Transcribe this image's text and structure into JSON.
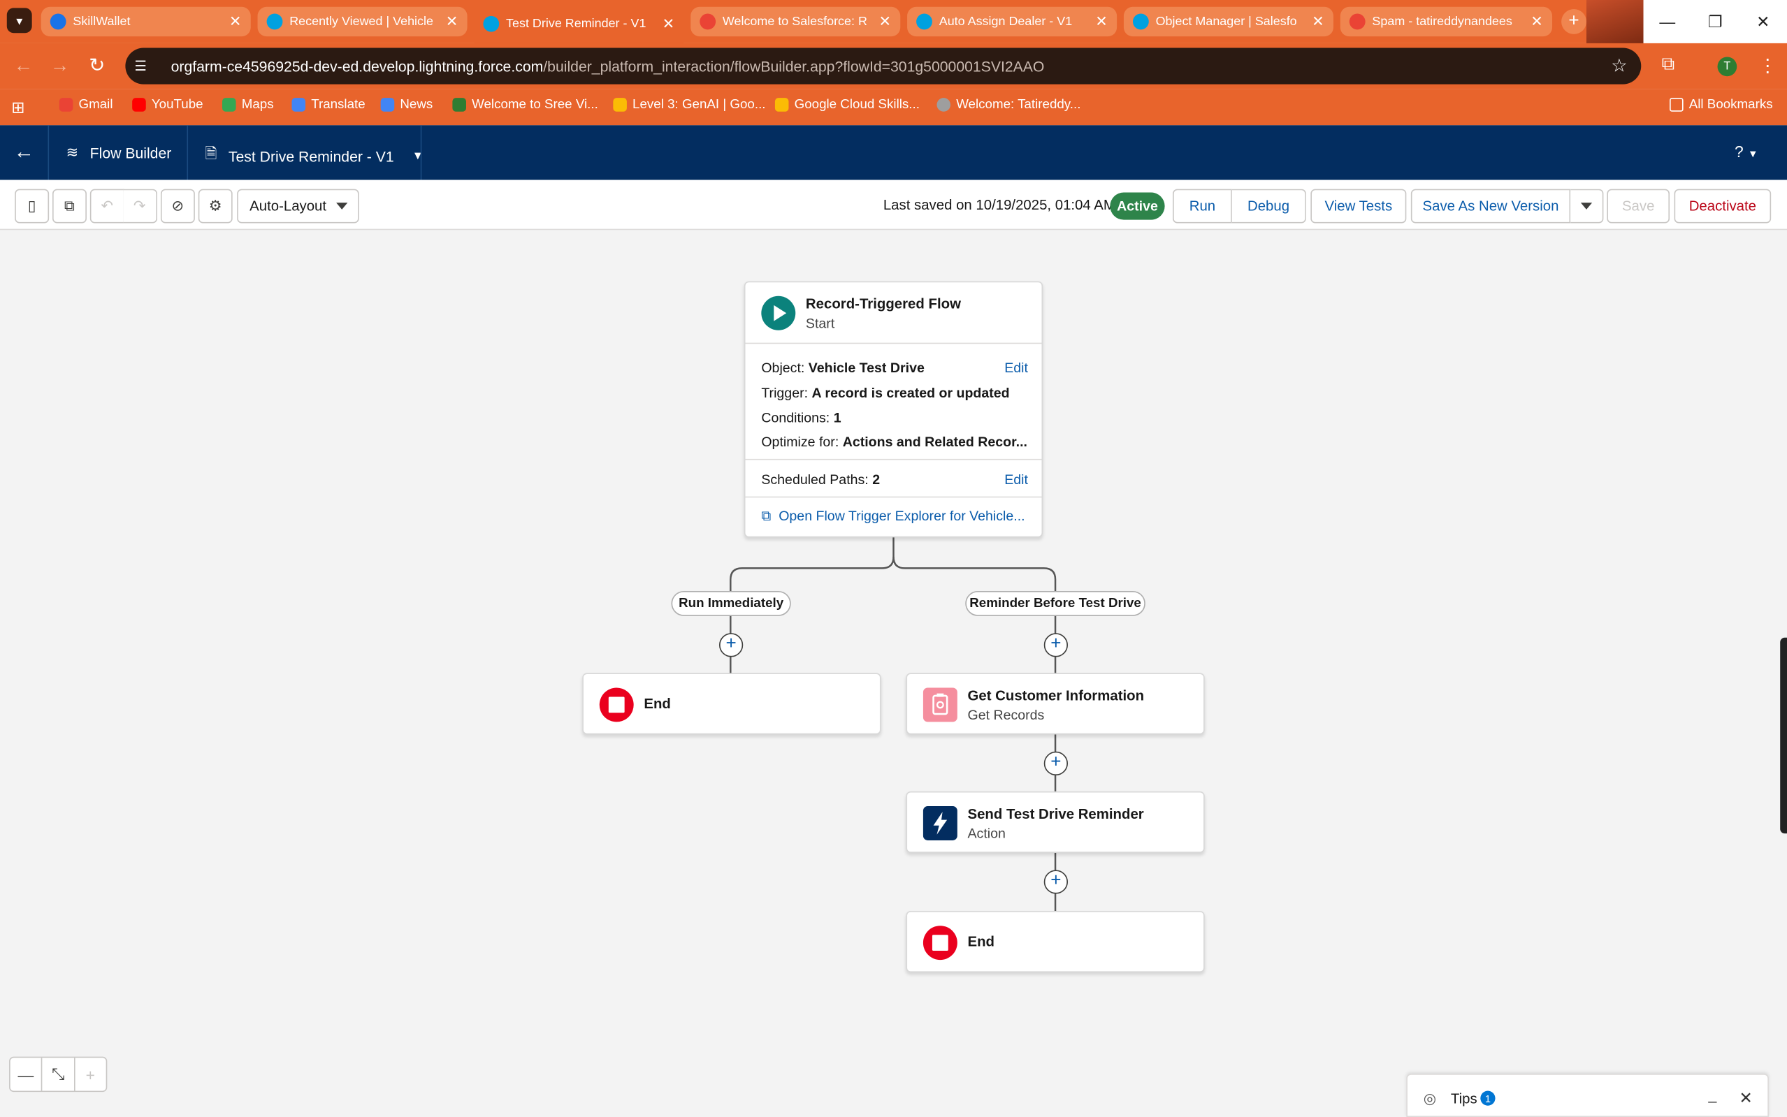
{
  "browser": {
    "tabs": [
      {
        "title": "SkillWallet",
        "fav_color": "#1a73e8"
      },
      {
        "title": "Recently Viewed | Vehicle",
        "fav_color": "#00a1e0"
      },
      {
        "title": "Test Drive Reminder - V1",
        "fav_color": "#00a1e0"
      },
      {
        "title": "Welcome to Salesforce: R",
        "fav_color": "#ea4335"
      },
      {
        "title": "Auto Assign Dealer - V1",
        "fav_color": "#00a1e0"
      },
      {
        "title": "Object Manager | Salesfo",
        "fav_color": "#00a1e0"
      },
      {
        "title": "Spam - tatireddynandees",
        "fav_color": "#ea4335"
      }
    ],
    "url_host": "orgfarm-ce4596925d-dev-ed.develop.lightning.force.com",
    "url_path": "/builder_platform_interaction/flowBuilder.app?flowId=301g5000001SVI2AAO",
    "avatar_letter": "T",
    "bookmarks": [
      "Gmail",
      "YouTube",
      "Maps",
      "Translate",
      "News",
      "Welcome to Sree Vi...",
      "Level 3: GenAI | Goo...",
      "Google Cloud Skills...",
      "Welcome: Tatireddy..."
    ],
    "all_bookmarks": "All Bookmarks",
    "accent": "#e8642c"
  },
  "header": {
    "app_name": "Flow Builder",
    "flow_name": "Test Drive Reminder - V1",
    "help": "?"
  },
  "toolbar": {
    "layout_mode": "Auto-Layout",
    "last_saved": "Last saved on 10/19/2025, 01:04 AM",
    "status": "Active",
    "run": "Run",
    "debug": "Debug",
    "view_tests": "View Tests",
    "save_as_new": "Save As New Version",
    "save": "Save",
    "deactivate": "Deactivate"
  },
  "start": {
    "title": "Record-Triggered Flow",
    "subtitle": "Start",
    "object_label": "Object:",
    "object_value": "Vehicle Test Drive",
    "trigger_label": "Trigger:",
    "trigger_value": "A record is created or updated",
    "conditions_label": "Conditions:",
    "conditions_value": "1",
    "optimize_label": "Optimize for:",
    "optimize_value": "Actions and Related Recor...",
    "scheduled_label": "Scheduled Paths:",
    "scheduled_value": "2",
    "edit": "Edit",
    "explorer_link": "Open Flow Trigger Explorer for Vehicle..."
  },
  "paths": {
    "left": "Run Immediately",
    "right": "Reminder Before Test Drive"
  },
  "nodes": {
    "left_end": "End",
    "get_title": "Get Customer Information",
    "get_sub": "Get Records",
    "action_title": "Send Test Drive Reminder",
    "action_sub": "Action",
    "right_end": "End"
  },
  "tips": {
    "label": "Tips",
    "count": "1"
  }
}
